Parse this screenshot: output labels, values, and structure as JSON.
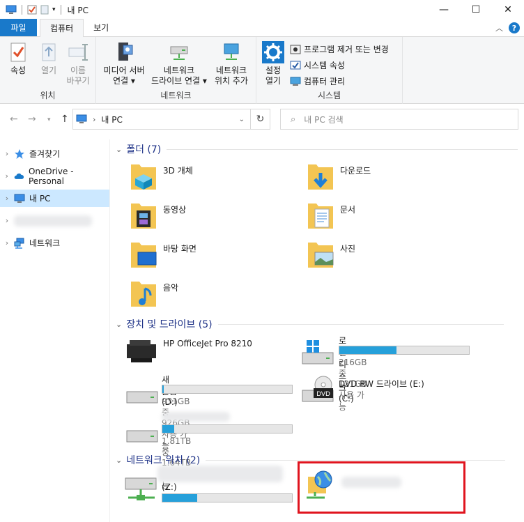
{
  "window": {
    "title": "내 PC"
  },
  "window_controls": {
    "minimize": "—",
    "maximize": "☐",
    "close": "✕"
  },
  "tabs": [
    {
      "label": "파일"
    },
    {
      "label": "컴퓨터"
    },
    {
      "label": "보기"
    }
  ],
  "ribbon": {
    "location_group": {
      "label": "위치",
      "properties": "속성",
      "open": "열기",
      "rename_1": "이름",
      "rename_2": "바꾸기"
    },
    "network_group": {
      "label": "네트워크",
      "media_1": "미디어 서버",
      "media_2": "연결 ▾",
      "map_1": "네트워크",
      "map_2": "드라이브 연결 ▾",
      "add_1": "네트워크",
      "add_2": "위치 추가"
    },
    "system_group": {
      "label": "시스템",
      "settings_1": "설정",
      "settings_2": "열기",
      "uninstall": "프로그램 제거 또는 변경",
      "sysprops": "시스템 속성",
      "manage": "컴퓨터 관리"
    }
  },
  "address": {
    "path": "내 PC",
    "search_placeholder": "내 PC 검색"
  },
  "nav": {
    "quick": "즐겨찾기",
    "onedrive": "OneDrive - Personal",
    "thispc": "내 PC",
    "network": "네트워크"
  },
  "folders_section": {
    "title": "폴더 (7)"
  },
  "folders": [
    {
      "name": "3D 개체"
    },
    {
      "name": "다운로드"
    },
    {
      "name": "동영상"
    },
    {
      "name": "문서"
    },
    {
      "name": "바탕 화면"
    },
    {
      "name": "사진"
    },
    {
      "name": "음악"
    }
  ],
  "devices_section": {
    "title": "장치 및 드라이브 (5)"
  },
  "devices": {
    "printer": "HP OfficeJet Pro 8210",
    "c_name": "로컬 디스크 (C:)",
    "c_sub": "216GB 중 121GB 사용 가능",
    "c_used_fraction": 0.44,
    "d_name": "새 볼륨 (D:)",
    "d_sub": "931GB 중 926GB 사용 가능",
    "d_used_fraction": 0.01,
    "e_name": "DVD RW 드라이브 (E:)",
    "dvd_badge": "DVD",
    "x_sub": "1.81TB 중 1.64TB 사용 가능",
    "x_used_fraction": 0.09
  },
  "network_section": {
    "title": "네트워크 위치 (2)"
  },
  "network_locations": {
    "z_label": "(Z:)",
    "z_used_fraction": 0.27
  },
  "colors": {
    "accent": "#1979ca",
    "bar_fill": "#26a0da",
    "selection": "#cce8ff",
    "highlight_box": "#e0141e"
  }
}
